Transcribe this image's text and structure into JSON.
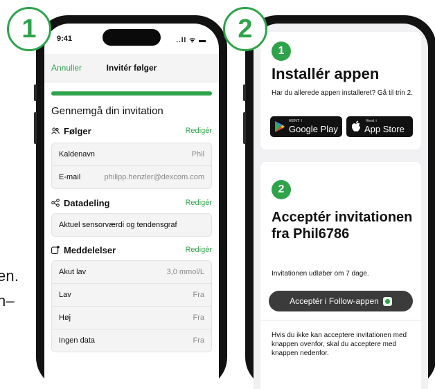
{
  "edge_text": {
    "line1": "en.",
    "line2": "n–"
  },
  "badges": {
    "first": "1",
    "second": "2"
  },
  "screen1": {
    "status_time": "9:41",
    "status_icons": "..ll ᯤ ▬",
    "nav": {
      "cancel": "Annuller",
      "title": "Invitér følger"
    },
    "review_title": "Gennemgå din invitation",
    "follower": {
      "label": "Følger",
      "icon": "people-icon",
      "edit": "Redigér",
      "rows": [
        {
          "key": "Kaldenavn",
          "value": "Phil"
        },
        {
          "key": "E-mail",
          "value": "philipp.henzler@dexcom.com"
        }
      ]
    },
    "sharing": {
      "label": "Datadeling",
      "icon": "share-icon",
      "edit": "Redigér",
      "value": "Aktuel sensorværdi og tendensgraf"
    },
    "notifications": {
      "label": "Meddelelser",
      "icon": "notification-icon",
      "edit": "Redigér",
      "rows": [
        {
          "key": "Akut lav",
          "value": "3,0 mmol/L"
        },
        {
          "key": "Lav",
          "value": "Fra"
        },
        {
          "key": "Høj",
          "value": "Fra"
        },
        {
          "key": "Ingen data",
          "value": "Fra"
        }
      ]
    }
  },
  "screen2": {
    "step1": {
      "number": "1",
      "title": "Installér appen",
      "subtitle": "Har du allerede appen installeret? Gå til trin 2.",
      "google_small": "HENT I",
      "google_big": "Google Play",
      "apple_small": "Hent i",
      "apple_big": "App Store"
    },
    "step2": {
      "number": "2",
      "title": "Acceptér invitationen fra Phil6786",
      "expire": "Invitationen udløber om 7 dage.",
      "button": "Acceptér i Follow-appen",
      "hint": "Hvis du ikke kan acceptere invitationen med knappen ovenfor, skal du acceptere med knappen nedenfor."
    }
  },
  "colors": {
    "accent": "#2ea34a",
    "frame": "#121212"
  }
}
